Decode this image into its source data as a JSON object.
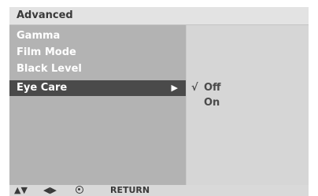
{
  "header": {
    "title": "Advanced"
  },
  "menu": {
    "items": [
      {
        "label": "Gamma"
      },
      {
        "label": "Film Mode"
      },
      {
        "label": "Black Level"
      },
      {
        "label": "Eye Care",
        "selected": true
      }
    ]
  },
  "submenu": {
    "options": [
      {
        "label": "Off",
        "checked": true,
        "check_symbol": "√"
      },
      {
        "label": "On",
        "checked": false,
        "check_symbol": ""
      }
    ]
  },
  "footer": {
    "navigate_symbol": "▲▼",
    "adjust_symbol": "◀▶",
    "return_label": "RETURN"
  },
  "colors": {
    "header_bg": "#e3e3e3",
    "left_panel_bg": "#b3b3b3",
    "right_panel_bg": "#d6d6d6",
    "selected_bg": "#4a4a4a"
  }
}
